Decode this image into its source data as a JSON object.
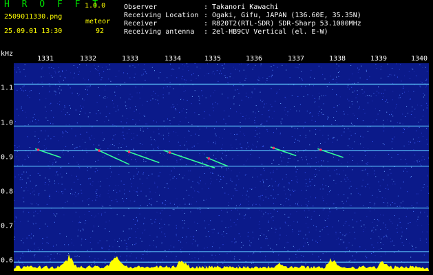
{
  "header": {
    "app_title": "H R O F F T",
    "app_version": "1.0.0",
    "file_name": "2509011330.png",
    "date_time": "25.09.01 13:30",
    "meteor_label": "meteor",
    "meteor_count": "92"
  },
  "info": [
    {
      "label": "Observer",
      "value": ": Takanori Kawachi"
    },
    {
      "label": "Receiving Location",
      "value": ": Ogaki, Gifu, JAPAN (136.60E, 35.35N)"
    },
    {
      "label": "Receiver",
      "value": ": R820T2(RTL-SDR) SDR-Sharp 53.1000MHz"
    },
    {
      "label": "Receiving antenna",
      "value": ": 2el-HB9CV Vertical (el. E-W)"
    }
  ],
  "axes": {
    "unit": "kHz",
    "x_ticks": [
      "1331",
      "1332",
      "1333",
      "1334",
      "1335",
      "1336",
      "1337",
      "1338",
      "1339",
      "1340"
    ],
    "y_ticks": [
      "1.1",
      "1.0",
      "0.9",
      "0.8",
      "0.7",
      "0.6"
    ]
  },
  "chart_data": {
    "type": "heatmap",
    "xlabel": "",
    "ylabel": "kHz",
    "xlim": [
      1330.6,
      1340.3
    ],
    "ylim": [
      0.585,
      1.18
    ],
    "x_ticks": [
      1331,
      1332,
      1333,
      1334,
      1335,
      1336,
      1337,
      1338,
      1339,
      1340
    ],
    "y_ticks": [
      1.1,
      1.0,
      0.9,
      0.8,
      0.7,
      0.6
    ],
    "carrier_lines_khz": [
      1.12,
      1.0,
      0.93,
      0.885,
      0.765,
      0.64,
      0.61
    ],
    "meteor_echoes": [
      {
        "x_start": 1331.1,
        "x_end": 1331.7,
        "y_start": 0.935,
        "y_end": 0.91
      },
      {
        "x_start": 1332.5,
        "x_end": 1333.3,
        "y_start": 0.935,
        "y_end": 0.89
      },
      {
        "x_start": 1333.2,
        "x_end": 1334.0,
        "y_start": 0.93,
        "y_end": 0.895
      },
      {
        "x_start": 1334.1,
        "x_end": 1335.3,
        "y_start": 0.93,
        "y_end": 0.88
      },
      {
        "x_start": 1335.1,
        "x_end": 1335.6,
        "y_start": 0.91,
        "y_end": 0.885
      },
      {
        "x_start": 1336.6,
        "x_end": 1337.2,
        "y_start": 0.94,
        "y_end": 0.915
      },
      {
        "x_start": 1337.7,
        "x_end": 1338.3,
        "y_start": 0.935,
        "y_end": 0.91
      }
    ],
    "colors": {
      "background": "#0b1a8a",
      "carrier": "#5fc8ff",
      "echo": "#33ff99",
      "echo_hot": "#ff3366",
      "activity": "#ffff00"
    }
  }
}
